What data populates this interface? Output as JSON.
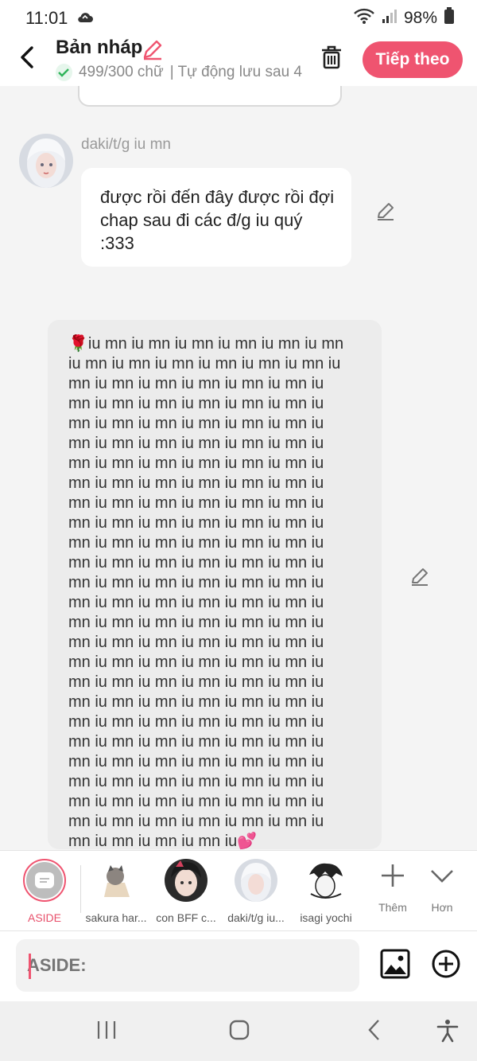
{
  "status": {
    "time": "11:01",
    "battery": "98%"
  },
  "header": {
    "title": "Bản nháp",
    "word_count": "499/300 chữ",
    "autosave": "| Tự động lưu sau 4",
    "next_label": "Tiếp theo"
  },
  "message1": {
    "sender": "daki/t/g iu mn",
    "text": "được rồi đến đây được rồi đợi chap sau đi các đ/g iu quý :333"
  },
  "message2": {
    "lines": [
      "🌹iu mn iu mn iu mn iu mn iu mn iu mn",
      "iu mn iu mn iu mn iu mn iu mn iu mn iu",
      "mn iu mn iu mn iu mn iu mn iu mn iu",
      "mn iu mn iu mn iu mn iu mn iu mn iu",
      "mn iu mn iu mn iu mn iu mn iu mn iu",
      "mn iu mn iu mn iu mn iu mn iu mn iu",
      "mn iu mn iu mn iu mn iu mn iu mn iu",
      "mn iu mn iu mn iu mn iu mn iu mn iu",
      "mn iu mn iu mn iu mn iu mn iu mn iu",
      "mn iu mn iu mn iu mn iu mn iu mn iu",
      "mn iu mn iu mn iu mn iu mn iu mn iu",
      "mn iu mn iu mn iu mn iu mn iu mn iu",
      "mn iu mn iu mn iu mn iu mn iu mn iu",
      "mn iu mn iu mn iu mn iu mn iu mn iu",
      "mn iu mn iu mn iu mn iu mn iu mn iu",
      "mn iu mn iu mn iu mn iu mn iu mn iu",
      "mn iu mn iu mn iu mn iu mn iu mn iu",
      "mn iu mn iu mn iu mn iu mn iu mn iu",
      "mn iu mn iu mn iu mn iu mn iu mn iu",
      "mn iu mn iu mn iu mn iu mn iu mn iu",
      "mn iu mn iu mn iu mn iu mn iu mn iu",
      "mn iu mn iu mn iu mn iu mn iu mn iu",
      "mn iu mn iu mn iu mn iu mn iu mn iu",
      "mn iu mn iu mn iu mn iu mn iu mn iu",
      "mn iu mn iu mn iu mn iu mn iu mn iu",
      "mn iu mn iu mn iu mn iu💕"
    ]
  },
  "characters": {
    "aside": "ASIDE",
    "c1": "sakura har...",
    "c2": "con BFF c...",
    "c3": "daki/t/g iu...",
    "c4": "isagi yochi",
    "more": "Thêm",
    "expand": "Hơn"
  },
  "input": {
    "placeholder": "ASIDE:"
  },
  "colors": {
    "accent": "#ef5470",
    "check": "#2fb45a"
  }
}
